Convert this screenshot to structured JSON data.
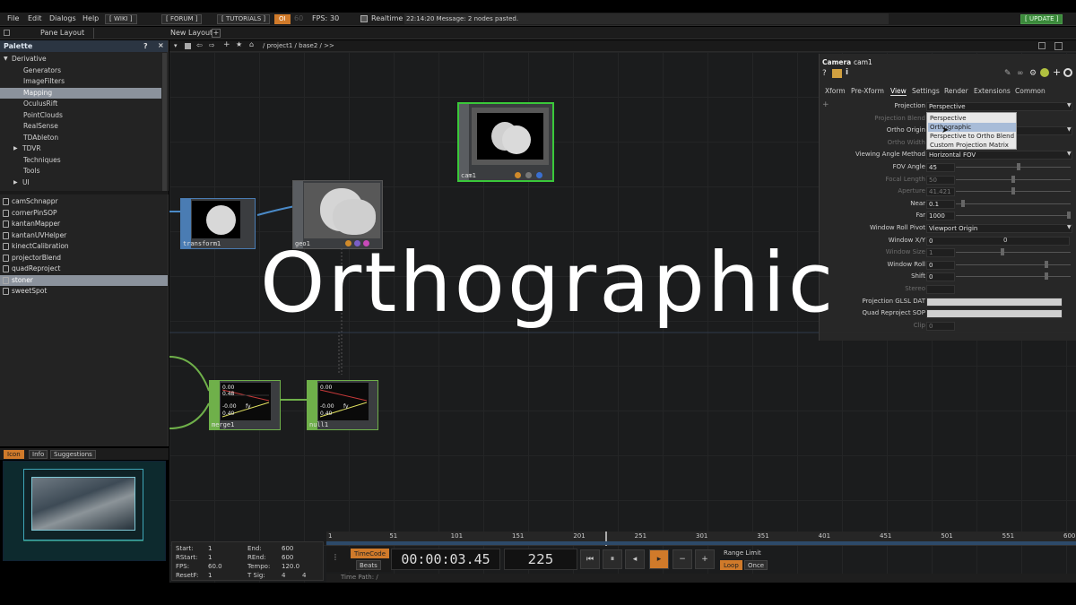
{
  "menubar": {
    "items": [
      "File",
      "Edit",
      "Dialogs",
      "Help"
    ],
    "wiki": "[ WIKI ]",
    "forum": "[ FORUM ]",
    "tutorials": "[ TUTORIALS ]",
    "oi": "OI",
    "fps_count": "60",
    "fps_label": "FPS:",
    "fps_value": "30",
    "realtime": "Realtime",
    "message": "22:14:20 Message: 2 nodes pasted.",
    "update": "[ UPDATE ]"
  },
  "secondbar": {
    "pane_layout": "Pane Layout",
    "new_layout": "New Layout"
  },
  "palette": {
    "title": "Palette",
    "help": "?",
    "close": "×",
    "tree": [
      {
        "label": "Derivative",
        "indent": 0,
        "arrow": "down"
      },
      {
        "label": "Generators",
        "indent": 2
      },
      {
        "label": "ImageFilters",
        "indent": 2
      },
      {
        "label": "Mapping",
        "indent": 2,
        "selected": true
      },
      {
        "label": "OculusRift",
        "indent": 2
      },
      {
        "label": "PointClouds",
        "indent": 2
      },
      {
        "label": "RealSense",
        "indent": 2
      },
      {
        "label": "TDAbleton",
        "indent": 2
      },
      {
        "label": "TDVR",
        "indent": 1,
        "arrow": "right"
      },
      {
        "label": "Techniques",
        "indent": 2
      },
      {
        "label": "Tools",
        "indent": 2
      },
      {
        "label": "UI",
        "indent": 1,
        "arrow": "right"
      }
    ],
    "files": [
      "camSchnappr",
      "cornerPinSOP",
      "kantanMapper",
      "kantanUVHelper",
      "kinectCalibration",
      "projectorBlend",
      "quadReproject",
      "stoner",
      "sweetSpot"
    ],
    "selected_file": "stoner"
  },
  "viewer_tabs": [
    "Icon",
    "Info",
    "Suggestions"
  ],
  "network": {
    "path": "/ project1 / base2 / >>",
    "nodes": {
      "transform": "transform1",
      "geo": "geo1",
      "cam": "cam1",
      "merge": "merge1",
      "null": "null1"
    },
    "chop_text": [
      "0.00",
      "0.48",
      "0.48",
      "-0.00",
      "fy",
      "0.40"
    ]
  },
  "params": {
    "type": "Camera",
    "name": "cam1",
    "tabs": [
      "Xform",
      "Pre-Xform",
      "View",
      "Settings",
      "Render",
      "Extensions",
      "Common"
    ],
    "active_tab": "View",
    "rows": [
      {
        "label": "Projection",
        "value": "Perspective"
      },
      {
        "label": "Projection Blend",
        "value": "",
        "dim": true
      },
      {
        "label": "Ortho Origin",
        "value": ""
      },
      {
        "label": "Ortho Width",
        "value": "",
        "dim": true
      },
      {
        "label": "Viewing Angle Method",
        "value": "Horizontal FOV"
      },
      {
        "label": "FOV Angle",
        "value": "45"
      },
      {
        "label": "Focal Length",
        "value": "50",
        "dim": true
      },
      {
        "label": "Aperture",
        "value": "41.421",
        "dim": true
      },
      {
        "label": "Near",
        "value": "0.1"
      },
      {
        "label": "Far",
        "value": "1000"
      },
      {
        "label": "Window Roll Pivot",
        "value": "Viewport Origin"
      },
      {
        "label": "Window X/Y",
        "value": "0",
        "value2": "0"
      },
      {
        "label": "Window Size",
        "value": "1",
        "dim": true
      },
      {
        "label": "Window Roll",
        "value": "0"
      },
      {
        "label": "Shift",
        "value": "0"
      },
      {
        "label": "Stereo",
        "value": "",
        "dim": true
      },
      {
        "label": "Projection GLSL DAT",
        "value": ""
      },
      {
        "label": "Quad Reproject SOP",
        "value": ""
      },
      {
        "label": "Clip",
        "value": "0",
        "dim": true
      }
    ],
    "dropdown_options": [
      "Perspective",
      "Orthographic",
      "Perspective to Ortho Blend",
      "Custom Projection Matrix"
    ],
    "dropdown_selected": "Orthographic"
  },
  "overlay_title": "Orthographic",
  "info": {
    "start": "1",
    "end": "600",
    "rstart": "1",
    "rend": "600",
    "fps": "60.0",
    "tempo": "120.0",
    "resetf": "1",
    "tsig_a": "4",
    "tsig_b": "4",
    "labels": {
      "start": "Start:",
      "end": "End:",
      "rstart": "RStart:",
      "rend": "REnd:",
      "fps": "FPS:",
      "tempo": "Tempo:",
      "resetf": "ResetF:",
      "tsig": "T Sig:"
    }
  },
  "timeline": {
    "ticks": [
      "1",
      "51",
      "101",
      "151",
      "201",
      "251",
      "301",
      "351",
      "401",
      "451",
      "501",
      "551",
      "600"
    ],
    "timecode_chip": "TimeCode",
    "beats_chip": "Beats",
    "timecode": "00:00:03.45",
    "frame": "225",
    "range_limit": "Range Limit",
    "loop": "Loop",
    "once": "Once",
    "time_path": "Time Path: /"
  }
}
